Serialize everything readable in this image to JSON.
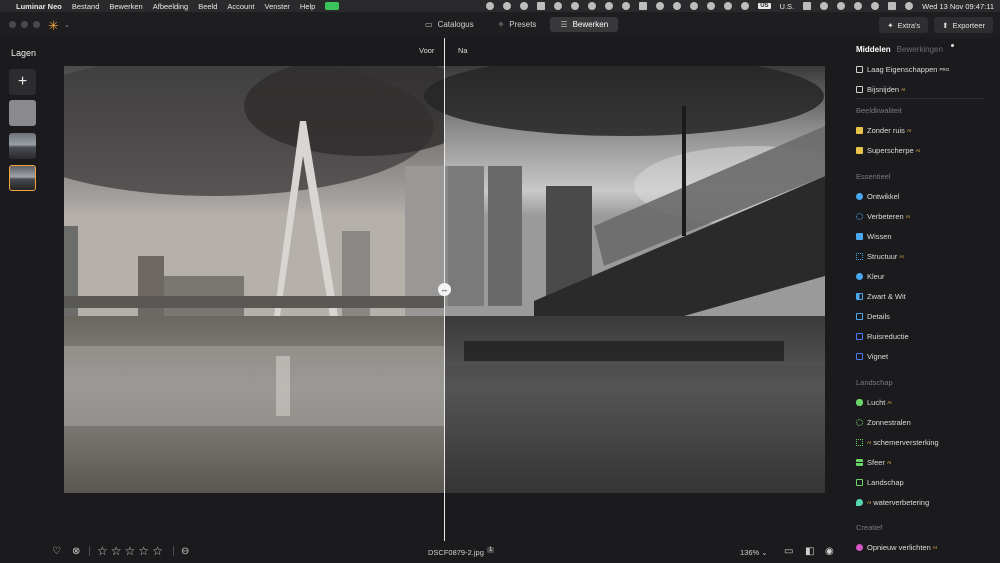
{
  "menubar": {
    "app_name": "Luminar Neo",
    "items": [
      "Bestand",
      "Bewerken",
      "Afbeelding",
      "Beeld",
      "Account",
      "Venster",
      "Help"
    ],
    "input_source": "US",
    "input_region": "U.S.",
    "clock": "Wed 13 Nov  09:47:11"
  },
  "toolbar": {
    "modes": [
      {
        "label": "Catalogus",
        "icon": "folder-icon"
      },
      {
        "label": "Presets",
        "icon": "sparkle-icon"
      },
      {
        "label": "Bewerken",
        "icon": "sliders-icon"
      }
    ],
    "active_mode": "Bewerken",
    "extras_label": "Extra's",
    "export_label": "Exporteer"
  },
  "layers": {
    "title": "Lagen",
    "add_symbol": "+"
  },
  "canvas": {
    "before_label": "Voor",
    "after_label": "Na",
    "split_symbol": "↔",
    "split_position": 0.5
  },
  "bottom_bar": {
    "rating": 0,
    "stars": [
      "☆",
      "☆",
      "☆",
      "☆",
      "☆"
    ],
    "filename": "DSCF0879-2.jpg",
    "file_badge": "1",
    "zoom": "136% ⌄"
  },
  "panel": {
    "tab_tools": "Middelen",
    "tab_edits": "Bewerkingen",
    "top_items": [
      {
        "label": "Laag Eigenschappen",
        "badge": "PRO"
      },
      {
        "label": "Bijsnijden",
        "badge": "AI"
      }
    ],
    "sections": [
      {
        "title": "Beeldkwaliteit",
        "items": [
          {
            "label": "Zonder ruis",
            "badge": "AI",
            "color": "#e8c24a"
          },
          {
            "label": "Superscherpe",
            "badge": "AI",
            "color": "#e8c24a"
          }
        ]
      },
      {
        "title": "Essentieel",
        "items": [
          {
            "label": "Ontwikkel",
            "badge": "",
            "color": "#4aa8f0"
          },
          {
            "label": "Verbeteren",
            "badge": "AI",
            "color": "#4aa8f0"
          },
          {
            "label": "Wissen",
            "badge": "",
            "color": "#4aa8f0"
          },
          {
            "label": "Structuur",
            "badge": "AI",
            "color": "#4aa8f0"
          },
          {
            "label": "Kleur",
            "badge": "",
            "color": "#4aa8f0"
          },
          {
            "label": "Zwart & Wit",
            "badge": "",
            "color": "#4aa8f0"
          },
          {
            "label": "Details",
            "badge": "",
            "color": "#4aa8f0"
          },
          {
            "label": "Ruisreductie",
            "badge": "",
            "color": "#4a78f0"
          },
          {
            "label": "Vignet",
            "badge": "",
            "color": "#4a78f0"
          }
        ]
      },
      {
        "title": "Landschap",
        "items": [
          {
            "label": "Lucht",
            "badge": "AI",
            "color": "#6ad66a"
          },
          {
            "label": "Zonnestralen",
            "badge": "",
            "color": "#6ad66a"
          },
          {
            "label": "schemerversterking",
            "badge_pre": "AI",
            "color": "#6ad66a"
          },
          {
            "label": "Sfeer",
            "badge": "AI",
            "color": "#6ad66a"
          },
          {
            "label": "Landschap",
            "badge": "",
            "color": "#6ad66a"
          },
          {
            "label": "waterverbetering",
            "badge_pre": "AI",
            "color": "#58d6b0"
          }
        ]
      },
      {
        "title": "Creatief",
        "items": [
          {
            "label": "Opnieuw verlichten",
            "badge": "AI",
            "color": "#d656c8"
          }
        ]
      }
    ]
  },
  "colors": {
    "accent": "#f2a33a",
    "background": "#1b1b1d",
    "panel": "#1b1b1d"
  }
}
